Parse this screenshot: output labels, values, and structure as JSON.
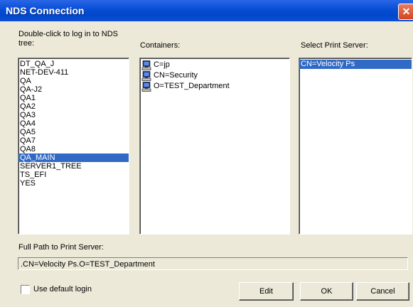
{
  "window": {
    "title": "NDS Connection",
    "close_glyph": "✕"
  },
  "tree_panel": {
    "label": "Double-click to log in to NDS tree:",
    "items": [
      "DT_QA_J",
      "NET-DEV-411",
      "QA",
      "QA-J2",
      "QA1",
      "QA2",
      "QA3",
      "QA4",
      "QA5",
      "QA7",
      "QA8",
      "QA_MAIN",
      "SERVER1_TREE",
      "TS_EFI",
      "YES"
    ],
    "selected": "QA_MAIN"
  },
  "containers_panel": {
    "label": "Containers:",
    "items": [
      {
        "label": "C=jp",
        "icon": "container-computer-icon"
      },
      {
        "label": "CN=Security",
        "icon": "container-computer-icon"
      },
      {
        "label": "O=TEST_Department",
        "icon": "container-computer-icon"
      }
    ]
  },
  "print_server_panel": {
    "label": "Select Print Server:",
    "items": [
      "CN=Velocity Ps"
    ],
    "selected": "CN=Velocity Ps"
  },
  "full_path": {
    "label": "Full Path to Print Server:",
    "value": ".CN=Velocity Ps.O=TEST_Department"
  },
  "use_default_login": {
    "label": "Use default login",
    "checked": false
  },
  "buttons": {
    "edit": "Edit",
    "ok": "OK",
    "cancel": "Cancel"
  },
  "colors": {
    "selection": "#316ac5",
    "title_bar": "#0a50d8",
    "dialog_bg": "#ece9d8"
  }
}
